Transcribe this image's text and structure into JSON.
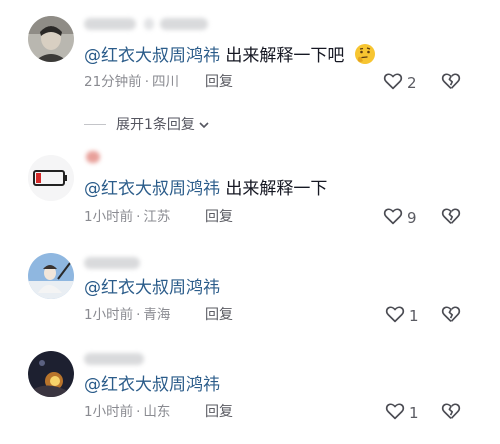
{
  "comments": [
    {
      "mention": "@红衣大叔周鸿祎",
      "text": " 出来解释一下吧",
      "emoji": "thinking-face-emoji",
      "time": "21分钟前",
      "location": "四川",
      "reply_label": "回复",
      "likes": "2"
    },
    {
      "mention": "@红衣大叔周鸿祎",
      "text": " 出来解释一下",
      "time": "1小时前",
      "location": "江苏",
      "reply_label": "回复",
      "likes": "9"
    },
    {
      "mention": "@红衣大叔周鸿祎",
      "text": "",
      "time": "1小时前",
      "location": "青海",
      "reply_label": "回复",
      "likes": "1"
    },
    {
      "mention": "@红衣大叔周鸿祎",
      "text": "",
      "time": "1小时前",
      "location": "山东",
      "reply_label": "回复",
      "likes": "1"
    }
  ],
  "expand_replies": {
    "label": "展开1条回复"
  },
  "icons": {
    "like": "heart-outline-icon",
    "dislike": "broken-heart-icon",
    "expand": "chevron-down-icon"
  },
  "colors": {
    "mention": "#2b5c8a",
    "meta": "#8a8b91",
    "icon": "#4a4b52"
  }
}
